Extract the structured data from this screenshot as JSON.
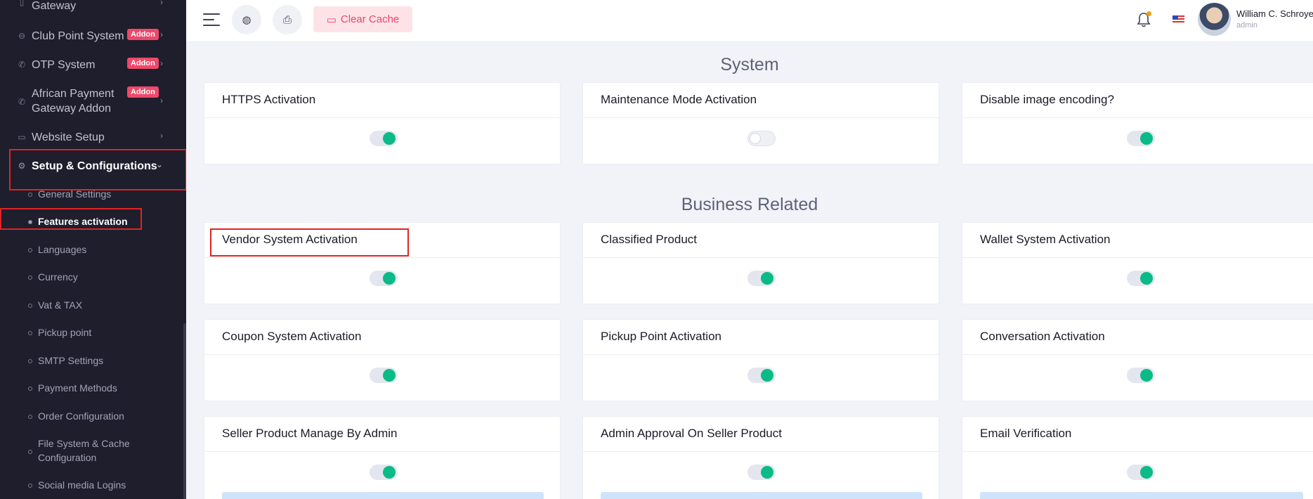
{
  "sidebar": {
    "items": [
      {
        "label": "Gateway",
        "icon": "card-icon"
      },
      {
        "label": "Club Point System",
        "badge": "Addon",
        "icon": "coin-icon"
      },
      {
        "label": "OTP System",
        "badge": "Addon",
        "icon": "phone-icon"
      },
      {
        "label": "African Payment Gateway Addon",
        "label_line1": "African Payment",
        "label_line2": "Gateway Addon",
        "badge": "Addon",
        "icon": "phone-icon"
      },
      {
        "label": "Website Setup",
        "icon": "monitor-icon"
      },
      {
        "label": "Setup & Configurations",
        "icon": "gear-icon"
      }
    ],
    "submenu": [
      "General Settings",
      "Features activation",
      "Languages",
      "Currency",
      "Vat & TAX",
      "Pickup point",
      "SMTP Settings",
      "Payment Methods",
      "Order Configuration",
      "File System & Cache Configuration",
      "Social media Logins"
    ],
    "submenu_file_line1": "File System & Cache",
    "submenu_file_line2": "Configuration"
  },
  "topbar": {
    "clear_cache": "Clear Cache",
    "user_name": "William C. Schroyer",
    "user_role": "admin"
  },
  "sections": {
    "system": "System",
    "business": "Business Related"
  },
  "cards": {
    "https": {
      "title": "HTTPS Activation",
      "on": true
    },
    "maintenance": {
      "title": "Maintenance Mode Activation",
      "on": false
    },
    "image_encoding": {
      "title": "Disable image encoding?",
      "on": true
    },
    "vendor": {
      "title": "Vendor System Activation",
      "on": true
    },
    "classified": {
      "title": "Classified Product",
      "on": true
    },
    "wallet": {
      "title": "Wallet System Activation",
      "on": true
    },
    "coupon": {
      "title": "Coupon System Activation",
      "on": true
    },
    "pickup": {
      "title": "Pickup Point Activation",
      "on": true
    },
    "conversation": {
      "title": "Conversation Activation",
      "on": true
    },
    "seller_manage": {
      "title": "Seller Product Manage By Admin",
      "on": true
    },
    "admin_approval": {
      "title": "Admin Approval On Seller Product",
      "on": true
    },
    "email_verify": {
      "title": "Email Verification",
      "on": true
    }
  },
  "colors": {
    "sidebar_bg": "#1e1e2d",
    "toggle_on": "#0abb87",
    "addon_badge": "#ef486a",
    "highlight": "#e02424"
  }
}
